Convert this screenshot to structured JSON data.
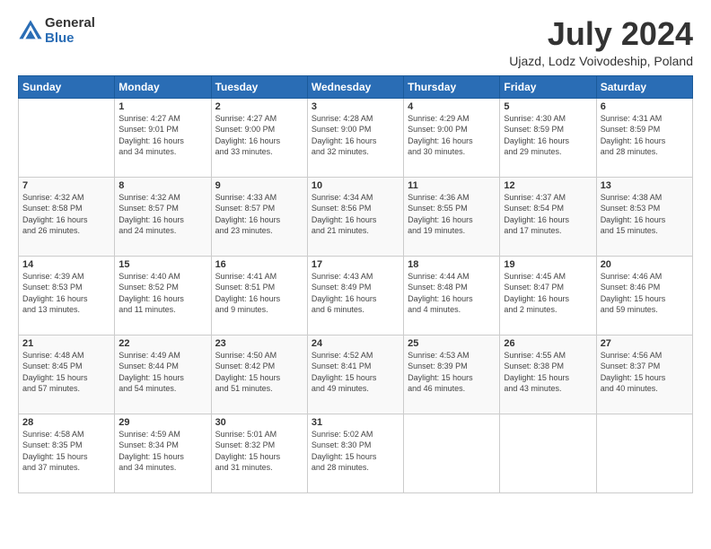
{
  "header": {
    "logo_general": "General",
    "logo_blue": "Blue",
    "month_title": "July 2024",
    "location": "Ujazd, Lodz Voivodeship, Poland"
  },
  "days_of_week": [
    "Sunday",
    "Monday",
    "Tuesday",
    "Wednesday",
    "Thursday",
    "Friday",
    "Saturday"
  ],
  "weeks": [
    [
      {
        "day": "",
        "info": ""
      },
      {
        "day": "1",
        "info": "Sunrise: 4:27 AM\nSunset: 9:01 PM\nDaylight: 16 hours\nand 34 minutes."
      },
      {
        "day": "2",
        "info": "Sunrise: 4:27 AM\nSunset: 9:00 PM\nDaylight: 16 hours\nand 33 minutes."
      },
      {
        "day": "3",
        "info": "Sunrise: 4:28 AM\nSunset: 9:00 PM\nDaylight: 16 hours\nand 32 minutes."
      },
      {
        "day": "4",
        "info": "Sunrise: 4:29 AM\nSunset: 9:00 PM\nDaylight: 16 hours\nand 30 minutes."
      },
      {
        "day": "5",
        "info": "Sunrise: 4:30 AM\nSunset: 8:59 PM\nDaylight: 16 hours\nand 29 minutes."
      },
      {
        "day": "6",
        "info": "Sunrise: 4:31 AM\nSunset: 8:59 PM\nDaylight: 16 hours\nand 28 minutes."
      }
    ],
    [
      {
        "day": "7",
        "info": "Sunrise: 4:32 AM\nSunset: 8:58 PM\nDaylight: 16 hours\nand 26 minutes."
      },
      {
        "day": "8",
        "info": "Sunrise: 4:32 AM\nSunset: 8:57 PM\nDaylight: 16 hours\nand 24 minutes."
      },
      {
        "day": "9",
        "info": "Sunrise: 4:33 AM\nSunset: 8:57 PM\nDaylight: 16 hours\nand 23 minutes."
      },
      {
        "day": "10",
        "info": "Sunrise: 4:34 AM\nSunset: 8:56 PM\nDaylight: 16 hours\nand 21 minutes."
      },
      {
        "day": "11",
        "info": "Sunrise: 4:36 AM\nSunset: 8:55 PM\nDaylight: 16 hours\nand 19 minutes."
      },
      {
        "day": "12",
        "info": "Sunrise: 4:37 AM\nSunset: 8:54 PM\nDaylight: 16 hours\nand 17 minutes."
      },
      {
        "day": "13",
        "info": "Sunrise: 4:38 AM\nSunset: 8:53 PM\nDaylight: 16 hours\nand 15 minutes."
      }
    ],
    [
      {
        "day": "14",
        "info": "Sunrise: 4:39 AM\nSunset: 8:53 PM\nDaylight: 16 hours\nand 13 minutes."
      },
      {
        "day": "15",
        "info": "Sunrise: 4:40 AM\nSunset: 8:52 PM\nDaylight: 16 hours\nand 11 minutes."
      },
      {
        "day": "16",
        "info": "Sunrise: 4:41 AM\nSunset: 8:51 PM\nDaylight: 16 hours\nand 9 minutes."
      },
      {
        "day": "17",
        "info": "Sunrise: 4:43 AM\nSunset: 8:49 PM\nDaylight: 16 hours\nand 6 minutes."
      },
      {
        "day": "18",
        "info": "Sunrise: 4:44 AM\nSunset: 8:48 PM\nDaylight: 16 hours\nand 4 minutes."
      },
      {
        "day": "19",
        "info": "Sunrise: 4:45 AM\nSunset: 8:47 PM\nDaylight: 16 hours\nand 2 minutes."
      },
      {
        "day": "20",
        "info": "Sunrise: 4:46 AM\nSunset: 8:46 PM\nDaylight: 15 hours\nand 59 minutes."
      }
    ],
    [
      {
        "day": "21",
        "info": "Sunrise: 4:48 AM\nSunset: 8:45 PM\nDaylight: 15 hours\nand 57 minutes."
      },
      {
        "day": "22",
        "info": "Sunrise: 4:49 AM\nSunset: 8:44 PM\nDaylight: 15 hours\nand 54 minutes."
      },
      {
        "day": "23",
        "info": "Sunrise: 4:50 AM\nSunset: 8:42 PM\nDaylight: 15 hours\nand 51 minutes."
      },
      {
        "day": "24",
        "info": "Sunrise: 4:52 AM\nSunset: 8:41 PM\nDaylight: 15 hours\nand 49 minutes."
      },
      {
        "day": "25",
        "info": "Sunrise: 4:53 AM\nSunset: 8:39 PM\nDaylight: 15 hours\nand 46 minutes."
      },
      {
        "day": "26",
        "info": "Sunrise: 4:55 AM\nSunset: 8:38 PM\nDaylight: 15 hours\nand 43 minutes."
      },
      {
        "day": "27",
        "info": "Sunrise: 4:56 AM\nSunset: 8:37 PM\nDaylight: 15 hours\nand 40 minutes."
      }
    ],
    [
      {
        "day": "28",
        "info": "Sunrise: 4:58 AM\nSunset: 8:35 PM\nDaylight: 15 hours\nand 37 minutes."
      },
      {
        "day": "29",
        "info": "Sunrise: 4:59 AM\nSunset: 8:34 PM\nDaylight: 15 hours\nand 34 minutes."
      },
      {
        "day": "30",
        "info": "Sunrise: 5:01 AM\nSunset: 8:32 PM\nDaylight: 15 hours\nand 31 minutes."
      },
      {
        "day": "31",
        "info": "Sunrise: 5:02 AM\nSunset: 8:30 PM\nDaylight: 15 hours\nand 28 minutes."
      },
      {
        "day": "",
        "info": ""
      },
      {
        "day": "",
        "info": ""
      },
      {
        "day": "",
        "info": ""
      }
    ]
  ]
}
